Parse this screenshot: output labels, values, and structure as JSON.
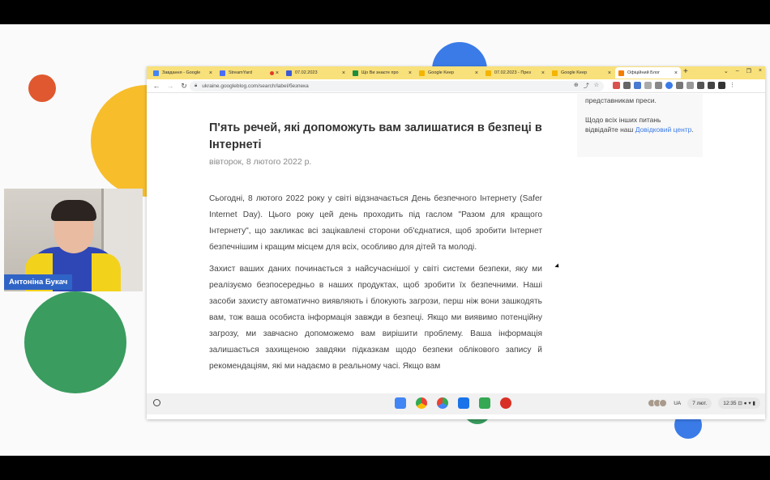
{
  "webcam": {
    "presenter_name": "Антоніна Букач"
  },
  "browser": {
    "tabs": [
      {
        "label": "Завдання - Google",
        "icon": "docs-icon",
        "color": "#4285f4"
      },
      {
        "label": "StreamYard",
        "icon": "streamyard-icon",
        "color": "#4a6cf7"
      },
      {
        "label": "07.02.2023",
        "icon": "docs-icon",
        "color": "#3b5bd6"
      },
      {
        "label": "Що Ви знаєте про",
        "icon": "sheets-icon",
        "color": "#1e8e3e"
      },
      {
        "label": "Google Keep",
        "icon": "keep-icon",
        "color": "#f4b400"
      },
      {
        "label": "07.02.2023 - През",
        "icon": "slides-icon",
        "color": "#f4b400"
      },
      {
        "label": "Google Keep",
        "icon": "keep-icon",
        "color": "#f4b400"
      },
      {
        "label": "Офіційний Блог",
        "icon": "blogger-icon",
        "color": "#f57d00"
      }
    ],
    "address": "ukraine.googleblog.com/search/label/безпека"
  },
  "sidebar": {
    "line1": "представникам преси.",
    "line2": "Щодо всіх інших питань відвідайте наш",
    "link": "Довідковий центр",
    "end": "."
  },
  "article": {
    "title": "П'ять речей, які допоможуть вам залишатися в безпеці в Інтернеті",
    "date": "вівторок, 8 лютого 2022 р.",
    "paragraph1": "Сьогодні, 8 лютого 2022 року у світі відзначається День безпечного Інтернету (Safer Internet Day). Цього року цей день проходить під гаслом \"Разом для кращого Інтернету\", що закликає всі зацікавлені сторони об'єднатися, щоб зробити Інтернет безпечнішим і кращим місцем для всіх, особливо для дітей та молоді.",
    "paragraph2": "Захист ваших даних починається з найсучаснішої у світі системи безпеки, яку ми реалізуємо безпосередньо в наших продуктах, щоб зробити їх безпечними. Наші засоби захисту автоматично виявляють і блокують загрози, перш ніж вони зашкодять вам, тож ваша особиста інформація завжди в безпеці. Якщо ми виявимо потенційну загрозу, ми завчасно допоможемо вам вирішити проблему. Ваша інформація залишається захищеною завдяки підказкам щодо безпеки облікового запису й рекомендаціям, які ми надаємо в реальному часі. Якщо вам"
  },
  "shelf": {
    "language": "UA",
    "date": "7 лют.",
    "time": "12:35"
  }
}
